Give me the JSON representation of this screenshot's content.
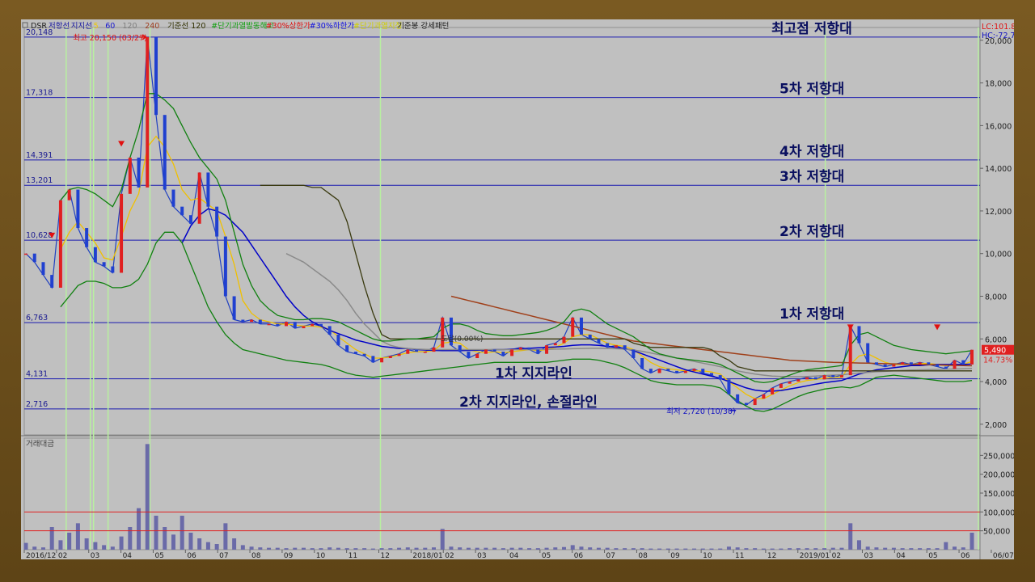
{
  "chart_data": {
    "type": "line",
    "ticker": "DSR",
    "legend": [
      {
        "label": "저항선",
        "color": "#1a1aa0"
      },
      {
        "label": "지지선",
        "color": "#1a1aa0"
      },
      {
        "label": "5",
        "color": "#f0c800"
      },
      {
        "label": "60",
        "color": "#1a1ad0"
      },
      {
        "label": "120",
        "color": "#808080"
      },
      {
        "label": "240",
        "color": "#a04020"
      },
      {
        "label": "기준선 120",
        "color": "#303000"
      },
      {
        "label": "#단기과열발동해고",
        "color": "#10a010"
      },
      {
        "label": "#30%상한가",
        "color": "#e01010"
      },
      {
        "label": "#30%하한가",
        "color": "#1010e0"
      },
      {
        "label": "#단기과열지정",
        "color": "#d0d000"
      },
      {
        "label": "기준봉 강세패턴",
        "color": "#202020"
      }
    ],
    "lc_label": "LC:101.84",
    "hc_label": "HC:-72.75",
    "price_axis": {
      "min": 1500,
      "max": 20600,
      "ticks": [
        "20,000",
        "18,000",
        "16,000",
        "14,000",
        "12,000",
        "10,000",
        "8,000",
        "6,000",
        "4,000",
        "2,000"
      ],
      "tick_values": [
        20000,
        18000,
        16000,
        14000,
        12000,
        10000,
        8000,
        6000,
        4000,
        2000
      ]
    },
    "volume_axis": {
      "min": 0,
      "max": 300000,
      "ticks": [
        "250,000",
        "200,000",
        "150,000",
        "100,000",
        "50,000"
      ],
      "tick_values": [
        250000,
        200000,
        150000,
        100000,
        50000
      ]
    },
    "x_ticks": [
      "2016/12",
      "02",
      "03",
      "04",
      "05",
      "06",
      "07",
      "08",
      "09",
      "10",
      "11",
      "12",
      "2018/01",
      "02",
      "03",
      "04",
      "05",
      "06",
      "07",
      "08",
      "09",
      "10",
      "11",
      "12",
      "2019/01",
      "02",
      "03",
      "04",
      "05",
      "06",
      "06/07"
    ],
    "levels": [
      {
        "value": 20148,
        "label": "20,148",
        "annotation": "최고점 저항대"
      },
      {
        "value": 17318,
        "label": "17,318",
        "annotation": "5차 저항대"
      },
      {
        "value": 14391,
        "label": "14,391",
        "annotation": "4차 저항대"
      },
      {
        "value": 13201,
        "label": "13,201",
        "annotation": "3차 저항대"
      },
      {
        "value": 10628,
        "label": "10,628",
        "annotation": "2차 저항대"
      },
      {
        "value": 6763,
        "label": "6,763",
        "annotation": "1차 저항대"
      },
      {
        "value": 4131,
        "label": "4,131",
        "annotation": "1차 지지라인"
      },
      {
        "value": 2716,
        "label": "2,716",
        "annotation": "2차 지지라인, 손절라인"
      }
    ],
    "high_note": "최고 20,150 (03/27)",
    "low_note": "최저 2,720 (10/30)",
    "mid_note": "도달(0.00%)",
    "current_price": "5,490",
    "current_change": "14.73%",
    "volume_title": "거래대금",
    "volume_ref_lines": [
      100000,
      50000
    ],
    "green_markers_month_index": [
      1.3,
      2.05,
      2.15,
      2.6,
      3.9,
      11.05,
      24.85,
      29.6
    ],
    "series": [
      {
        "name": "price_close",
        "values": [
          10000,
          9600,
          9000,
          8400,
          12500,
          13000,
          11200,
          10300,
          9600,
          9400,
          9100,
          12800,
          14500,
          13100,
          20150,
          16500,
          13000,
          12200,
          11800,
          11400,
          13800,
          12200,
          10800,
          8000,
          6900,
          6800,
          6900,
          6700,
          6700,
          6600,
          6800,
          6500,
          6600,
          6700,
          6600,
          6200,
          5700,
          5400,
          5300,
          5200,
          4900,
          5100,
          5200,
          5300,
          5500,
          5400,
          5400,
          5600,
          7000,
          5700,
          5400,
          5100,
          5300,
          5500,
          5400,
          5200,
          5500,
          5600,
          5500,
          5300,
          5700,
          5800,
          6100,
          7000,
          6200,
          6000,
          5800,
          5600,
          5700,
          5500,
          5100,
          4600,
          4400,
          4600,
          4500,
          4400,
          4500,
          4600,
          4400,
          4300,
          4100,
          3400,
          3000,
          2900,
          3200,
          3400,
          3700,
          3900,
          4000,
          4100,
          4200,
          4100,
          4300,
          4200,
          4300,
          6600,
          5800,
          4900,
          4800,
          4700,
          4800,
          4900,
          4800,
          4900,
          4800,
          4700,
          4600,
          5000,
          4800,
          5490
        ]
      },
      {
        "name": "ma5",
        "values": [
          null,
          null,
          null,
          null,
          10200,
          11000,
          11500,
          11000,
          10500,
          9800,
          9700,
          10800,
          12000,
          12800,
          15000,
          15500,
          15000,
          14200,
          13000,
          12500,
          12600,
          12300,
          12000,
          10800,
          9500,
          7800,
          7200,
          6900,
          6800,
          6700,
          6700,
          6650,
          6600,
          6600,
          6550,
          6450,
          6100,
          5800,
          5500,
          5300,
          5100,
          5100,
          5150,
          5250,
          5350,
          5400,
          5400,
          5450,
          5800,
          5850,
          5800,
          5500,
          5400,
          5350,
          5400,
          5350,
          5400,
          5450,
          5500,
          5450,
          5500,
          5600,
          5800,
          6100,
          6200,
          6200,
          6000,
          5800,
          5700,
          5650,
          5500,
          5200,
          4900,
          4700,
          4600,
          4550,
          4500,
          4500,
          4500,
          4450,
          4350,
          4000,
          3700,
          3400,
          3200,
          3200,
          3400,
          3600,
          3800,
          3950,
          4050,
          4100,
          4150,
          4200,
          4200,
          4800,
          5200,
          5300,
          5100,
          4900,
          4800,
          4800,
          4800,
          4850,
          4850,
          4800,
          4750,
          4800,
          4800,
          4950
        ]
      },
      {
        "name": "ma60",
        "values": [
          null,
          null,
          null,
          null,
          null,
          null,
          null,
          null,
          null,
          null,
          null,
          null,
          null,
          null,
          null,
          null,
          null,
          null,
          10500,
          11300,
          11800,
          12100,
          12000,
          11800,
          11400,
          11000,
          10400,
          9800,
          9200,
          8600,
          8000,
          7500,
          7100,
          6800,
          6600,
          6400,
          6250,
          6100,
          5950,
          5850,
          5750,
          5650,
          5600,
          5550,
          5550,
          5500,
          5480,
          5460,
          5450,
          5450,
          5450,
          5460,
          5470,
          5480,
          5500,
          5500,
          5520,
          5540,
          5560,
          5580,
          5600,
          5620,
          5650,
          5700,
          5720,
          5720,
          5700,
          5650,
          5600,
          5550,
          5450,
          5300,
          5150,
          5000,
          4850,
          4700,
          4550,
          4450,
          4350,
          4250,
          4150,
          4000,
          3850,
          3700,
          3600,
          3550,
          3550,
          3580,
          3650,
          3720,
          3800,
          3880,
          3950,
          4000,
          4050,
          4200,
          4350,
          4450,
          4550,
          4600,
          4650,
          4700,
          4750,
          4750,
          4780,
          4800,
          4800,
          4800,
          4800,
          4820
        ]
      },
      {
        "name": "ma120",
        "values": [
          null,
          null,
          null,
          null,
          null,
          null,
          null,
          null,
          null,
          null,
          null,
          null,
          null,
          null,
          null,
          null,
          null,
          null,
          null,
          null,
          null,
          null,
          null,
          null,
          null,
          null,
          null,
          null,
          null,
          null,
          10000,
          9800,
          9600,
          9300,
          9000,
          8700,
          8300,
          7800,
          7200,
          6700,
          6300,
          5900,
          5700,
          5600,
          5550,
          5520,
          5510,
          5500,
          5500,
          5500,
          5500,
          5500,
          5500,
          5500,
          5500,
          5500,
          5500,
          5500,
          5500,
          5500,
          5510,
          5520,
          5530,
          5540,
          5550,
          5560,
          5560,
          5550,
          5540,
          5520,
          5480,
          5420,
          5340,
          5260,
          5180,
          5100,
          5020,
          4940,
          4860,
          4780,
          4700,
          4600,
          4500,
          4420,
          4350,
          4300,
          4260,
          4240,
          4230,
          4230,
          4240,
          4260,
          4280,
          4300,
          4320,
          4360,
          4400,
          4430,
          4460,
          4480,
          4500,
          4520,
          4540,
          4550,
          4560,
          4570,
          4580,
          4590,
          4600,
          4620
        ]
      },
      {
        "name": "ma240",
        "values": [
          null,
          null,
          null,
          null,
          null,
          null,
          null,
          null,
          null,
          null,
          null,
          null,
          null,
          null,
          null,
          null,
          null,
          null,
          null,
          null,
          null,
          null,
          null,
          null,
          null,
          null,
          null,
          null,
          null,
          null,
          null,
          null,
          null,
          null,
          null,
          null,
          null,
          null,
          null,
          null,
          null,
          null,
          null,
          null,
          null,
          null,
          null,
          null,
          null,
          8000,
          7900,
          7800,
          7700,
          7600,
          7500,
          7400,
          7300,
          7200,
          7100,
          7000,
          6900,
          6800,
          6700,
          6600,
          6500,
          6400,
          6300,
          6200,
          6100,
          6000,
          5900,
          5850,
          5800,
          5750,
          5700,
          5650,
          5600,
          5550,
          5500,
          5450,
          5400,
          5350,
          5300,
          5250,
          5200,
          5150,
          5100,
          5050,
          5000,
          4980,
          4960,
          4940,
          4920,
          4900,
          4890,
          4880,
          4870,
          4860,
          4850,
          4840,
          4830,
          4820,
          4810,
          4800,
          4790,
          4780,
          4770,
          4760,
          4750,
          4740
        ]
      },
      {
        "name": "kijun120",
        "values": [
          null,
          null,
          null,
          null,
          null,
          null,
          null,
          null,
          null,
          null,
          null,
          null,
          null,
          null,
          null,
          null,
          null,
          null,
          null,
          null,
          null,
          null,
          null,
          null,
          null,
          null,
          null,
          13200,
          13200,
          13200,
          13200,
          13200,
          13200,
          13100,
          13100,
          12800,
          12500,
          11500,
          10000,
          8500,
          7200,
          6200,
          6000,
          6000,
          6000,
          6000,
          6000,
          6000,
          6000,
          6000,
          6000,
          6000,
          6000,
          6000,
          6000,
          6000,
          6000,
          6000,
          6000,
          6000,
          6000,
          6000,
          6000,
          6000,
          6000,
          6000,
          6000,
          6000,
          6000,
          6000,
          5800,
          5700,
          5600,
          5600,
          5600,
          5600,
          5600,
          5600,
          5600,
          5500,
          5200,
          5000,
          4700,
          4600,
          4500,
          4500,
          4500,
          4500,
          4500,
          4500,
          4500,
          4500,
          4500,
          4500,
          4500,
          4500,
          4500,
          4500,
          4500,
          4500,
          4500,
          4500,
          4500,
          4500,
          4500,
          4500,
          4500,
          4500,
          4500,
          4500
        ]
      },
      {
        "name": "bb_upper",
        "values": [
          null,
          null,
          null,
          null,
          12500,
          13000,
          13100,
          13000,
          12800,
          12500,
          12200,
          13000,
          14500,
          15800,
          17500,
          17500,
          17200,
          16800,
          16000,
          15200,
          14500,
          14000,
          13500,
          12500,
          11000,
          9500,
          8500,
          7800,
          7400,
          7100,
          7000,
          6900,
          6900,
          6950,
          6950,
          6900,
          6800,
          6600,
          6400,
          6200,
          6000,
          5900,
          5900,
          5950,
          6000,
          6000,
          6050,
          6100,
          6500,
          6700,
          6700,
          6600,
          6400,
          6250,
          6200,
          6150,
          6150,
          6200,
          6250,
          6300,
          6400,
          6550,
          6800,
          7300,
          7400,
          7300,
          7000,
          6700,
          6500,
          6300,
          6100,
          5800,
          5500,
          5300,
          5200,
          5100,
          5050,
          5000,
          4950,
          4900,
          4800,
          4600,
          4400,
          4200,
          4000,
          3950,
          4000,
          4150,
          4300,
          4450,
          4550,
          4600,
          4650,
          4700,
          4750,
          5700,
          6200,
          6300,
          6100,
          5900,
          5700,
          5600,
          5500,
          5450,
          5400,
          5350,
          5300,
          5350,
          5400,
          5450
        ]
      },
      {
        "name": "bb_lower",
        "values": [
          null,
          null,
          null,
          null,
          7500,
          8000,
          8500,
          8700,
          8700,
          8600,
          8400,
          8400,
          8500,
          8800,
          9500,
          10500,
          11000,
          11000,
          10500,
          9500,
          8500,
          7500,
          6800,
          6200,
          5800,
          5500,
          5400,
          5300,
          5200,
          5100,
          5000,
          4950,
          4900,
          4850,
          4800,
          4700,
          4550,
          4400,
          4300,
          4250,
          4200,
          4250,
          4300,
          4350,
          4400,
          4450,
          4500,
          4550,
          4600,
          4650,
          4700,
          4750,
          4800,
          4850,
          4900,
          4900,
          4900,
          4900,
          4900,
          4900,
          4900,
          4950,
          5000,
          5050,
          5050,
          5050,
          5000,
          4900,
          4800,
          4650,
          4450,
          4250,
          4050,
          3950,
          3900,
          3850,
          3850,
          3850,
          3850,
          3800,
          3700,
          3400,
          3100,
          2850,
          2650,
          2600,
          2700,
          2900,
          3100,
          3300,
          3450,
          3550,
          3650,
          3700,
          3750,
          3700,
          3800,
          4000,
          4200,
          4250,
          4300,
          4250,
          4200,
          4150,
          4100,
          4050,
          4000,
          4000,
          4000,
          4050
        ]
      },
      {
        "name": "volume",
        "values": [
          18000,
          8000,
          6000,
          60000,
          25000,
          45000,
          70000,
          30000,
          20000,
          12000,
          8000,
          35000,
          60000,
          110000,
          280000,
          90000,
          60000,
          40000,
          90000,
          45000,
          30000,
          20000,
          15000,
          70000,
          30000,
          12000,
          8000,
          6000,
          5000,
          5000,
          4000,
          5000,
          5000,
          4000,
          4000,
          6000,
          5000,
          4000,
          4000,
          4000,
          3000,
          4000,
          4000,
          5000,
          6000,
          5000,
          5000,
          6000,
          55000,
          8000,
          6000,
          5000,
          5000,
          5000,
          5000,
          4000,
          5000,
          5000,
          4000,
          4000,
          5000,
          6000,
          7000,
          12000,
          8000,
          6000,
          5000,
          5000,
          4000,
          4000,
          4000,
          4000,
          3000,
          3000,
          3000,
          3000,
          3000,
          3000,
          3000,
          3000,
          3000,
          8000,
          6000,
          4000,
          4000,
          3000,
          3000,
          3000,
          4000,
          4000,
          4000,
          4000,
          4000,
          5000,
          5000,
          70000,
          25000,
          8000,
          6000,
          5000,
          5000,
          4000,
          4000,
          4000,
          4000,
          4000,
          20000,
          8000,
          6000,
          45000
        ]
      }
    ]
  }
}
